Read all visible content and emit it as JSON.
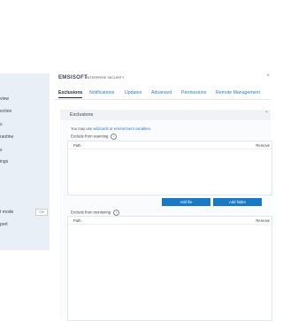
{
  "sidebar": {
    "items": [
      {
        "label": "view"
      },
      {
        "label": "ection"
      },
      {
        "label": "s"
      },
      {
        "label": "rantine"
      },
      {
        "label": "s"
      },
      {
        "label": "ings"
      },
      {
        "label": "t mode"
      },
      {
        "label": "port"
      }
    ],
    "toggle_label": "Off"
  },
  "header": {
    "logo": "EMSISOFT",
    "product": "ENTERPRISE SECURITY",
    "close_glyph": "×"
  },
  "tabs": [
    {
      "label": "Exclusions",
      "active": true
    },
    {
      "label": "Notifications"
    },
    {
      "label": "Updates"
    },
    {
      "label": "Advanced"
    },
    {
      "label": "Permissions"
    },
    {
      "label": "Remote Management"
    }
  ],
  "exclusions": {
    "title": "Exclusions",
    "hint_prefix": "You may use ",
    "hint_link1": "wildcards",
    "hint_mid": " or ",
    "hint_link2": "environment variables",
    "hint_suffix": ".",
    "scanning": {
      "label": "Exclude from scanning",
      "columns": {
        "path": "Path",
        "remove": "Remove"
      }
    },
    "monitoring": {
      "label": "Exclude from monitoring",
      "columns": {
        "path": "Path",
        "remove": "Remove"
      }
    },
    "add_file_label": "Add file",
    "add_folder_label": "Add folder"
  }
}
